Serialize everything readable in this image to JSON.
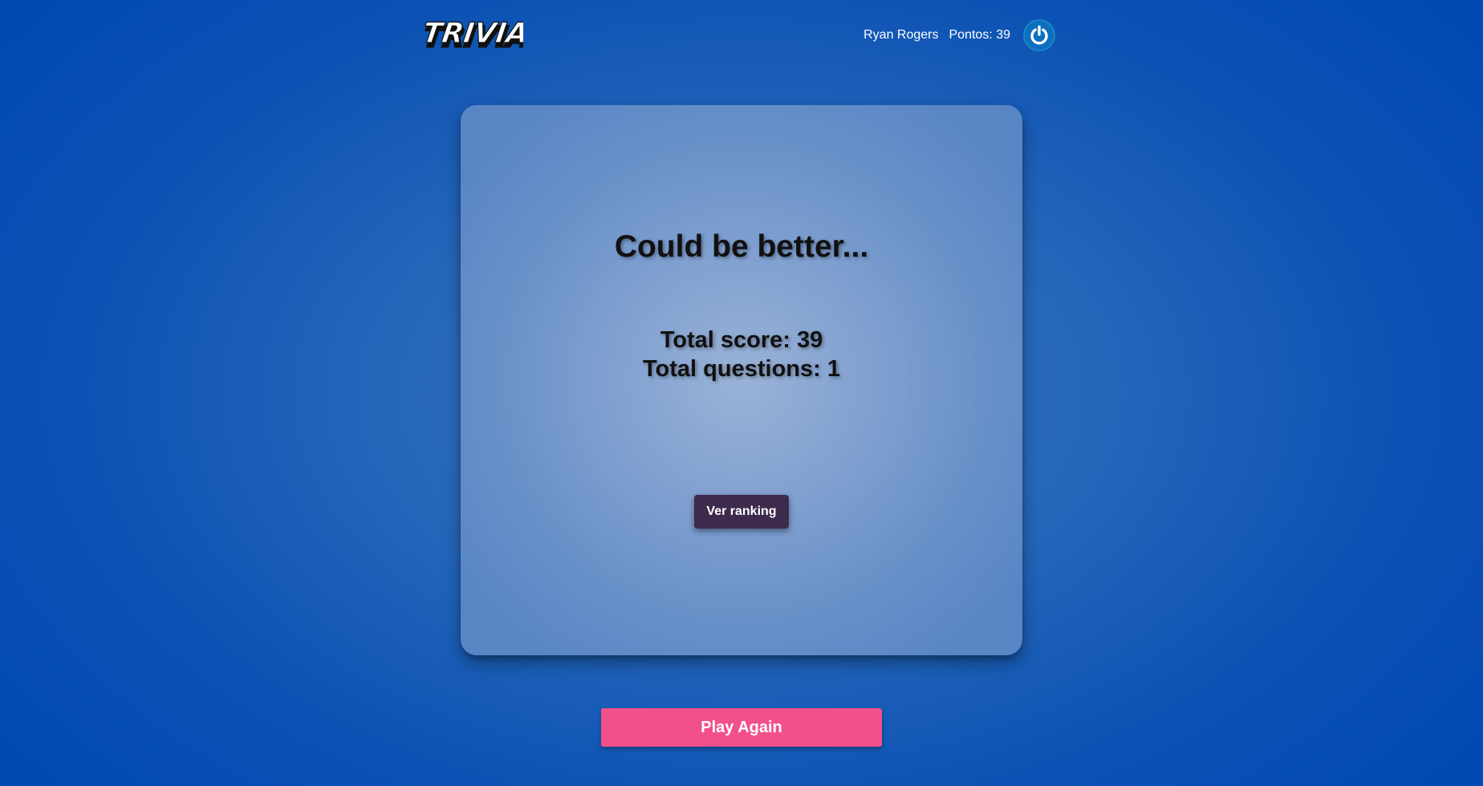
{
  "header": {
    "logo_text": "TRIVIA",
    "player_name": "Ryan Rogers",
    "score_label": "Pontos: 39",
    "avatar_icon": "power-icon"
  },
  "feedback": {
    "message": "Could be better...",
    "total_score": "Total score: 39",
    "total_questions": "Total questions: 1",
    "ranking_button": "Ver ranking"
  },
  "actions": {
    "play_again": "Play Again"
  },
  "colors": {
    "background": "#0c52b4",
    "card": "#7f9fd0",
    "ranking_button": "#3d2a4d",
    "play_again_button": "#f2508a"
  }
}
